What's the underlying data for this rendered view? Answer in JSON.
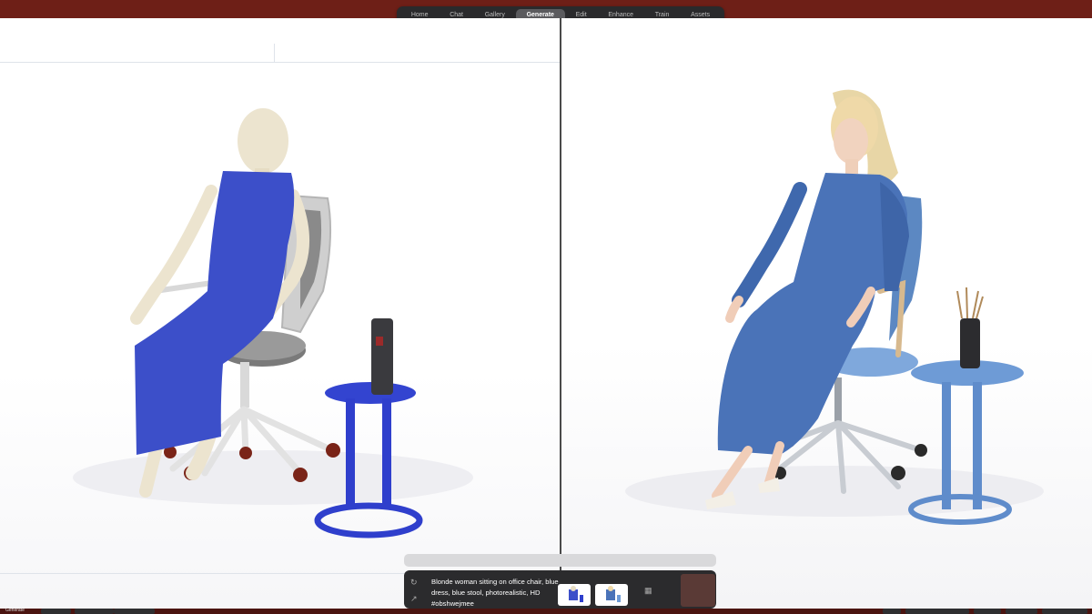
{
  "nav": {
    "items": [
      {
        "label": "Home"
      },
      {
        "label": "Chat"
      },
      {
        "label": "Gallery"
      },
      {
        "label": "Generate"
      },
      {
        "label": "Edit"
      },
      {
        "label": "Enhance"
      },
      {
        "label": "Train"
      },
      {
        "label": "Assets"
      }
    ],
    "active": "Generate"
  },
  "prompt": {
    "text": "Blonde woman sitting on office chair, blue dress, blue stool, photorealistic, HD #obshwejmee",
    "icons": [
      "refresh-icon",
      "link-icon",
      "layout-icon"
    ]
  },
  "status": {
    "label": "Generate"
  },
  "colors": {
    "topbar": "#6e1f17",
    "nav_bg": "#2a2a2c",
    "accent_blue": "#3c4fc9",
    "dress_blue": "#4a73b8",
    "stool_blue": "#6e9bd6"
  }
}
